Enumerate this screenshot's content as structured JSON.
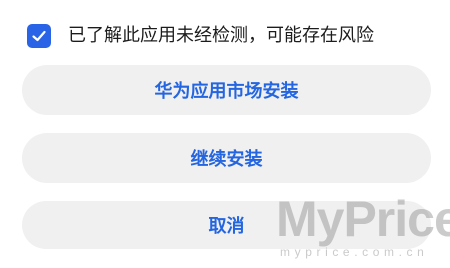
{
  "consent": {
    "checked": true,
    "text": "已了解此应用未经检测，可能存在风险"
  },
  "buttons": {
    "huawei_install": "华为应用市场安装",
    "continue_install": "继续安装",
    "cancel": "取消"
  },
  "watermark": {
    "brand": "MyPrice",
    "url": "myprice.com.cn"
  },
  "colors": {
    "accent": "#2465e0",
    "checkbox": "#2a64e6",
    "button_bg": "#f0f0f0"
  },
  "icons": {
    "checkbox_mark": "checkmark-icon"
  }
}
